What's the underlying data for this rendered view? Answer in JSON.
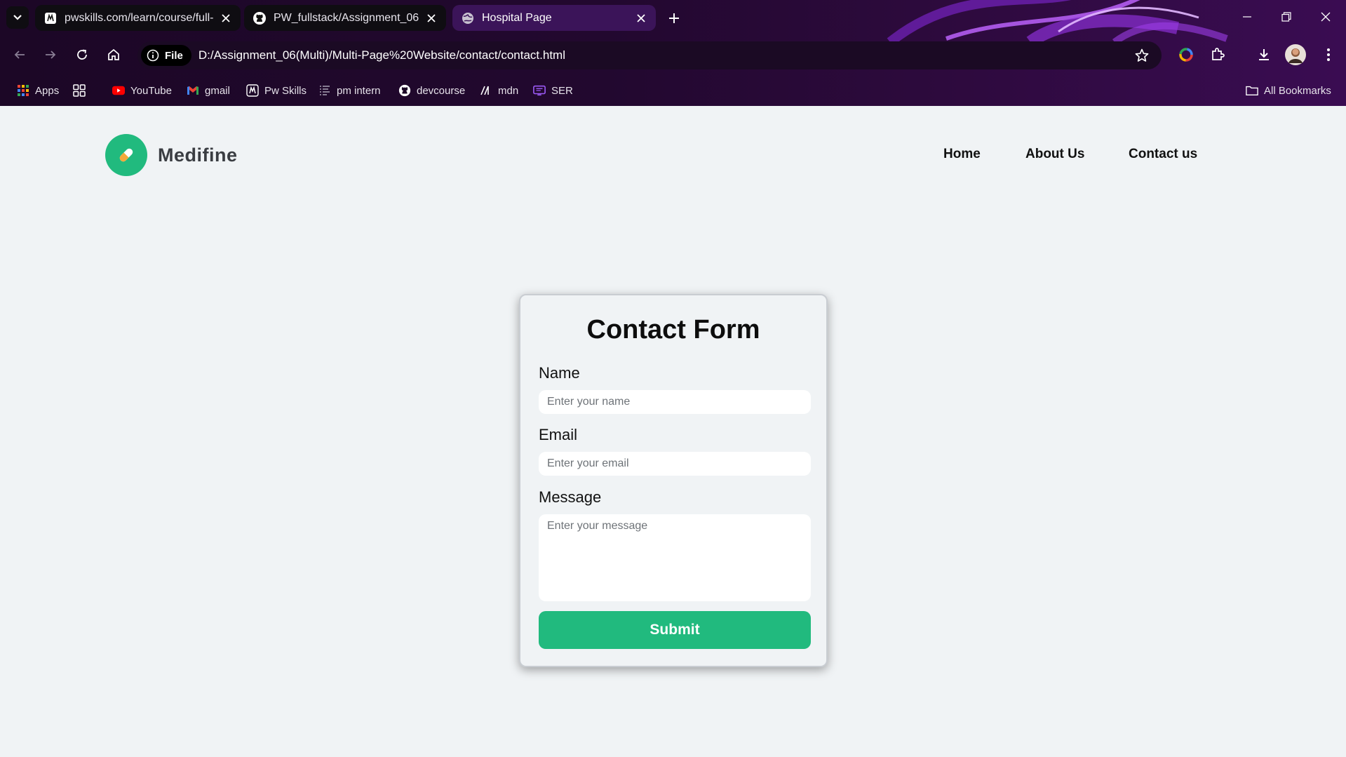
{
  "browser": {
    "tabs": [
      {
        "title": "pwskills.com/learn/course/full-s",
        "favicon": "pwskills-icon",
        "active": false
      },
      {
        "title": "PW_fullstack/Assignment_06(M",
        "favicon": "github-icon",
        "active": false
      },
      {
        "title": "Hospital Page",
        "favicon": "globe-icon",
        "active": true
      }
    ],
    "site_info_label": "File",
    "url": "D:/Assignment_06(Multi)/Multi-Page%20Website/contact/contact.html",
    "bookmarks": [
      {
        "label": "Apps",
        "icon": "apps-grid-icon"
      },
      {
        "label": "YouTube",
        "icon": "youtube-icon"
      },
      {
        "label": "gmail",
        "icon": "gmail-icon"
      },
      {
        "label": "Pw Skills",
        "icon": "pwskills-icon"
      },
      {
        "label": "pm intern",
        "icon": "list-icon"
      },
      {
        "label": "devcourse",
        "icon": "github-icon"
      },
      {
        "label": "mdn",
        "icon": "mdn-icon"
      },
      {
        "label": "SER",
        "icon": "ser-icon"
      }
    ],
    "all_bookmarks_label": "All Bookmarks"
  },
  "site": {
    "brand": "Medifine",
    "accent_color": "#21ba7e",
    "nav": [
      {
        "label": "Home"
      },
      {
        "label": "About Us"
      },
      {
        "label": "Contact us"
      }
    ]
  },
  "form": {
    "title": "Contact Form",
    "name_label": "Name",
    "name_placeholder": "Enter your name",
    "email_label": "Email",
    "email_placeholder": "Enter your email",
    "message_label": "Message",
    "message_placeholder": "Enter your message",
    "submit_label": "Submit"
  }
}
